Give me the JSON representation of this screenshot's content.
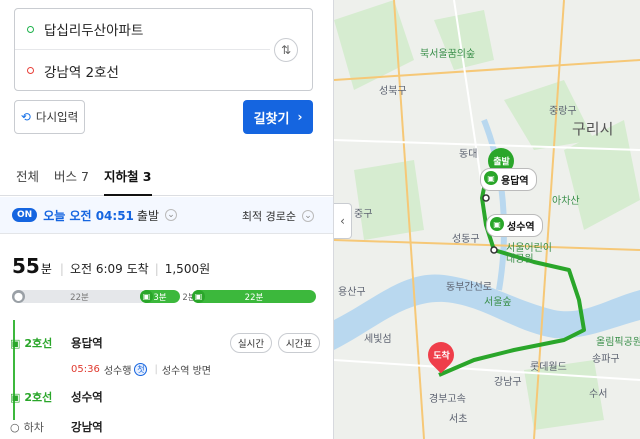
{
  "search": {
    "origin": "답십리두산아파트",
    "destination": "강남역 2호선",
    "reset_label": "다시입력",
    "search_label": "길찾기"
  },
  "tabs": [
    {
      "label": "전체"
    },
    {
      "label": "버스 7"
    },
    {
      "label": "지하철 3"
    }
  ],
  "depart": {
    "badge": "ON",
    "time": "오늘 오전 04:51",
    "suffix": "출발",
    "sort_label": "최적 경로순"
  },
  "route": {
    "duration_num": "55",
    "duration_unit": "분",
    "arrival": "오전 6:09 도착",
    "fare": "1,500원",
    "bar": [
      {
        "label": "22분",
        "type": "walk",
        "share": 0.39
      },
      {
        "label": "3분",
        "type": "subway",
        "share": 0.06
      },
      {
        "label": "2분",
        "type": "walk",
        "share": 0.04
      },
      {
        "label": "22분",
        "type": "subway",
        "share": 0.39
      }
    ]
  },
  "steps": [
    {
      "line": "2호선",
      "station": "용답역",
      "arrival_time": "05:36",
      "direction": "성수행",
      "badge": "첫",
      "note": "성수역 방면",
      "btn_realtime": "실시간",
      "btn_timetable": "시간표"
    },
    {
      "line": "2호선",
      "station": "성수역"
    },
    {
      "line": "하차",
      "station": "강남역"
    }
  ],
  "map": {
    "labels": {
      "park1": "북서울꿈의숲",
      "seongbuk": "성북구",
      "jungnang": "중랑구",
      "guri": "구리시",
      "gwangjin_park": "서울어린이\n대공원",
      "jung": "중구",
      "seongdong": "성동구",
      "achasan": "아차산",
      "yongsan": "용산구",
      "dongbu": "동부간선로",
      "seoulsup": "서울숲",
      "songpa": "송파구",
      "gangnam": "강남구",
      "olympic": "올림픽공원",
      "lotte": "롯데월드",
      "sebitseom": "세빛섬",
      "seocho": "서초",
      "suseo": "수서",
      "gyeongbu": "경부고속",
      "dong": "동대"
    },
    "chips": {
      "yongdap": "용답역",
      "seongsu": "성수역"
    },
    "markers": {
      "start": "출발",
      "end": "도착"
    },
    "colors": {
      "route": "#2aa62a",
      "river": "#b9d8ef",
      "park": "#d6ecd0"
    }
  }
}
